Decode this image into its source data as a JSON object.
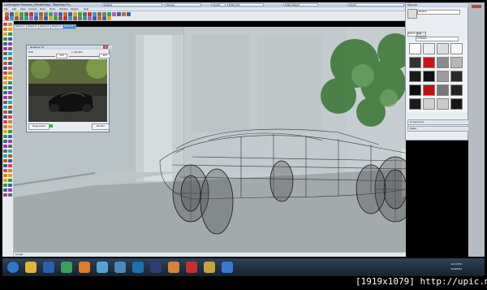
{
  "window": {
    "title": "Lamborghini Reventon_Render5.skp - SketchUp Pro",
    "outliner_label": "Outliner",
    "scenes_label": "Scenes",
    "layer_value": "Layer0",
    "entity_info_label": "Entity Info",
    "soften_edges_label": "Soften Edges",
    "layers_label": "Layers"
  },
  "menu": [
    "File",
    "Edit",
    "View",
    "Camera",
    "Draw",
    "Tools",
    "Window",
    "Plugins",
    "Help"
  ],
  "scene_tabs": [
    "Scene 1",
    "Scene 2",
    "Scene 3",
    "Scene 4",
    "Scene 5"
  ],
  "active_scene_index": 4,
  "render_window": {
    "title": "Renderer V2",
    "spp_label": "SSD",
    "value_left": "100",
    "mid_label": "1 / Render",
    "value_right": "220",
    "regenerate_label": "Regenerate",
    "render_label": "Render"
  },
  "materials_panel": {
    "title": "Materials",
    "material_name": "Default",
    "tab_select": "Select",
    "tab_edit": "Edit",
    "dropdown_value": "In Model",
    "components_label": "Components",
    "styles_label": "Styles",
    "swatch_colors": [
      "#ffffff",
      "#e8eef2",
      "#d8dde2",
      "#f5f7f9",
      "#333333",
      "#c91414",
      "#8a8a8a",
      "#b7b7b7",
      "#1a1a1a",
      "#111111",
      "#9d9d9d",
      "#2a2a2a",
      "#0d0d0d",
      "#c40e0e",
      "#777777",
      "#242424",
      "#1b1b1b",
      "#cfcfcf",
      "#cbcbcb",
      "#161616"
    ]
  },
  "statusbar": {
    "text": "Length"
  },
  "taskbar": {
    "clock_time": "10:10 PM",
    "clock_date": "5/13/2013",
    "apps": [
      "start-orb",
      "explorer",
      "media-player",
      "chrome",
      "firefox",
      "messenger",
      "network",
      "photoshop",
      "lightroom",
      "illustrator",
      "sketchup",
      "folder",
      "maps"
    ]
  },
  "watermark": "[1919x1079] http://upic.me/"
}
